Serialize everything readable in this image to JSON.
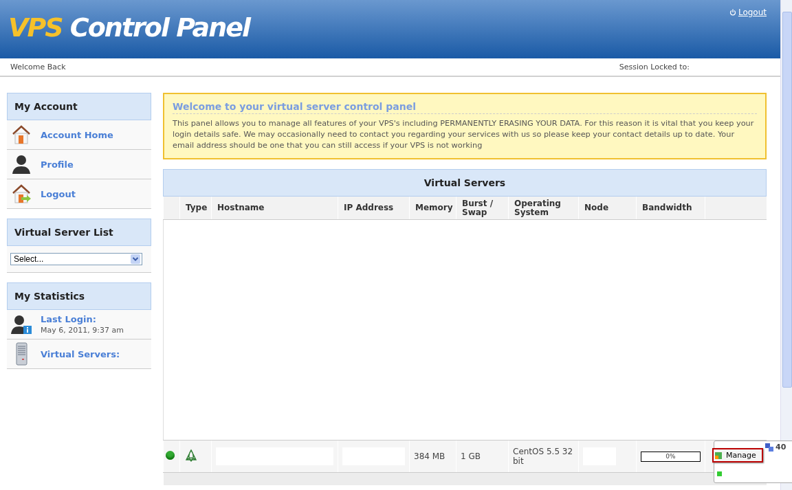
{
  "header": {
    "logo_accent": "VPS",
    "logo_rest": "Control Panel",
    "logout": "Logout"
  },
  "welcome_bar": {
    "greeting": "Welcome Back",
    "session": "Session Locked to:"
  },
  "sidebar": {
    "account": {
      "title": "My Account",
      "items": [
        {
          "label": "Account Home",
          "kind": "home"
        },
        {
          "label": "Profile",
          "kind": "user"
        },
        {
          "label": "Logout",
          "kind": "exit"
        }
      ]
    },
    "server_list": {
      "title": "Virtual Server List",
      "select": "Select..."
    },
    "statistics": {
      "title": "My Statistics",
      "items": [
        {
          "label": "Last Login:",
          "value": "May 6, 2011, 9:37 am",
          "kind": "user"
        },
        {
          "label": "Virtual Servers:",
          "kind": "server"
        }
      ]
    }
  },
  "notice": {
    "title": "Welcome to your virtual server control panel",
    "text": "This panel allows you to manage all features of your VPS's including PERMANENTLY ERASING YOUR DATA. For this reason it is vital that you keep your login details safe. We may occasionally need to contact you regarding your services with us so please keep your contact details up to date. Your email address should be one that you can still access if your VPS is not working"
  },
  "table": {
    "title": "Virtual Servers",
    "columns": [
      "",
      "Type",
      "Hostname",
      "IP Address",
      "Memory",
      "Burst / Swap",
      "Operating System",
      "Node",
      "Bandwidth",
      ""
    ],
    "rows": [
      {
        "online": true,
        "memory": "384 MB",
        "burst": "1 GB",
        "os": "CentOS 5.5 32 bit",
        "bandwidth": {
          "level": 0,
          "reading": "0%"
        },
        "action": "Manage"
      }
    ]
  },
  "popup": {
    "count": "40"
  }
}
